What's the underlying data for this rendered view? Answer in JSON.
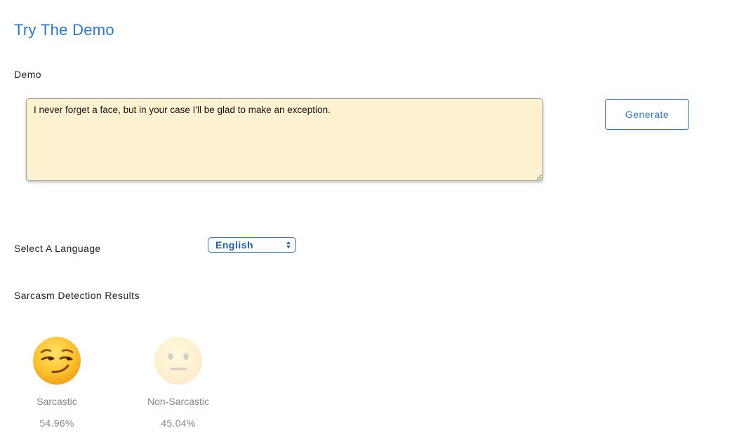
{
  "title": "Try The Demo",
  "demo": {
    "label": "Demo",
    "text": "I never forget a face, but in your case I'll be glad to make an exception.",
    "background_color": "#fdf2d0"
  },
  "generate_button": {
    "label": "Generate"
  },
  "language": {
    "label": "Select A Language",
    "selected": "English"
  },
  "results": {
    "label": "Sarcasm Detection Results",
    "items": [
      {
        "label": "Sarcastic",
        "percent": "54.96%",
        "icon": "smirking-face-emoji"
      },
      {
        "label": "Non-Sarcastic",
        "percent": "45.04%",
        "icon": "neutral-face-emoji"
      }
    ]
  },
  "colors": {
    "accent": "#2a78d2",
    "muted_text": "#888888"
  }
}
